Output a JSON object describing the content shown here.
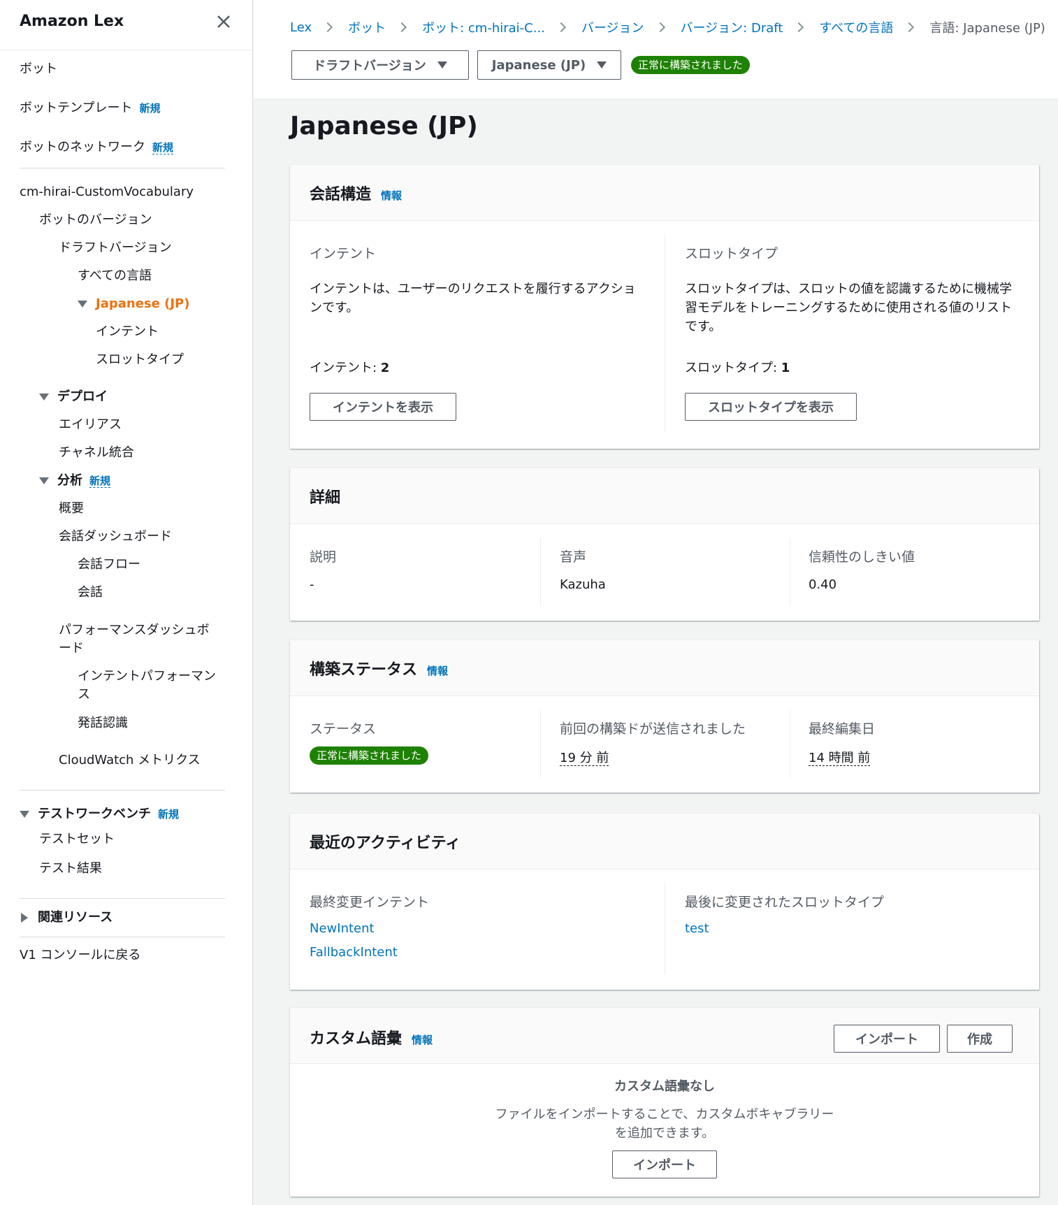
{
  "sidebar": {
    "title": "Amazon Lex",
    "new_badge": "新規",
    "items": {
      "bots": "ボット",
      "bot_templates": "ボットテンプレート",
      "bot_network": "ボットのネットワーク",
      "bot_name": "cm-hirai-CustomVocabulary",
      "bot_versions": "ボットのバージョン",
      "draft_version": "ドラフトバージョン",
      "all_languages": "すべての言語",
      "japanese": "Japanese (JP)",
      "intents": "インテント",
      "slot_types": "スロットタイプ",
      "deploy": "デプロイ",
      "aliases": "エイリアス",
      "channel_integrations": "チャネル統合",
      "analytics": "分析",
      "overview": "概要",
      "conversation_dashboard": "会話ダッシュボード",
      "conversation_flow": "会話フロー",
      "conversations": "会話",
      "performance_dashboard": "パフォーマンスダッシュボード",
      "intent_performance": "インテントパフォーマンス",
      "utterance_recognition": "発話認識",
      "cloudwatch_metrics": "CloudWatch メトリクス",
      "test_workbench": "テストワークベンチ",
      "test_sets": "テストセット",
      "test_results": "テスト結果",
      "related_resources": "関連リソース",
      "v1_console": "V1 コンソールに戻る"
    }
  },
  "breadcrumb": [
    "Lex",
    "ボット",
    "ボット: cm-hirai-C...",
    "バージョン",
    "バージョン: Draft",
    "すべての言語"
  ],
  "breadcrumb_current": "言語: Japanese (JP)",
  "toolbar": {
    "version_dropdown": "ドラフトバージョン",
    "language_dropdown": "Japanese (JP)",
    "status": "正常に構築されました"
  },
  "page_title": "Japanese (JP)",
  "info_label": "情報",
  "conversation_structure": {
    "title": "会話構造",
    "intents_heading": "インテント",
    "intents_desc": "インテントは、ユーザーのリクエストを履行するアクションです。",
    "intents_count_label": "インテント: ",
    "intents_count": "2",
    "intents_button": "インテントを表示",
    "slots_heading": "スロットタイプ",
    "slots_desc": "スロットタイプは、スロットの値を認識するために機械学習モデルをトレーニングするために使用される値のリストです。",
    "slots_count_label": "スロットタイプ: ",
    "slots_count": "1",
    "slots_button": "スロットタイプを表示"
  },
  "details": {
    "title": "詳細",
    "description_label": "説明",
    "description_value": "-",
    "voice_label": "音声",
    "voice_value": "Kazuha",
    "confidence_label": "信頼性のしきい値",
    "confidence_value": "0.40"
  },
  "build_status": {
    "title": "構築ステータス",
    "status_label": "ステータス",
    "status_value": "正常に構築されました",
    "last_build_label": "前回の構築ドが送信されました",
    "last_build_value": "19 分 前",
    "last_edited_label": "最終編集日",
    "last_edited_value": "14 時間 前"
  },
  "recent_activity": {
    "title": "最近のアクティビティ",
    "intents_label": "最終変更インテント",
    "intents": [
      "NewIntent",
      "FallbackIntent"
    ],
    "slots_label": "最後に変更されたスロットタイプ",
    "slots": [
      "test"
    ]
  },
  "custom_vocabulary": {
    "title": "カスタム語彙",
    "import_button": "インポート",
    "create_button": "作成",
    "empty_title": "カスタム語彙なし",
    "empty_desc_1": "ファイルをインポートすることで、カスタムボキャブラリー",
    "empty_desc_2": "を追加できます。",
    "empty_import_button": "インポート"
  },
  "colors": {
    "link": "#0073bb",
    "active_nav": "#ec7211",
    "success": "#1d8102"
  }
}
